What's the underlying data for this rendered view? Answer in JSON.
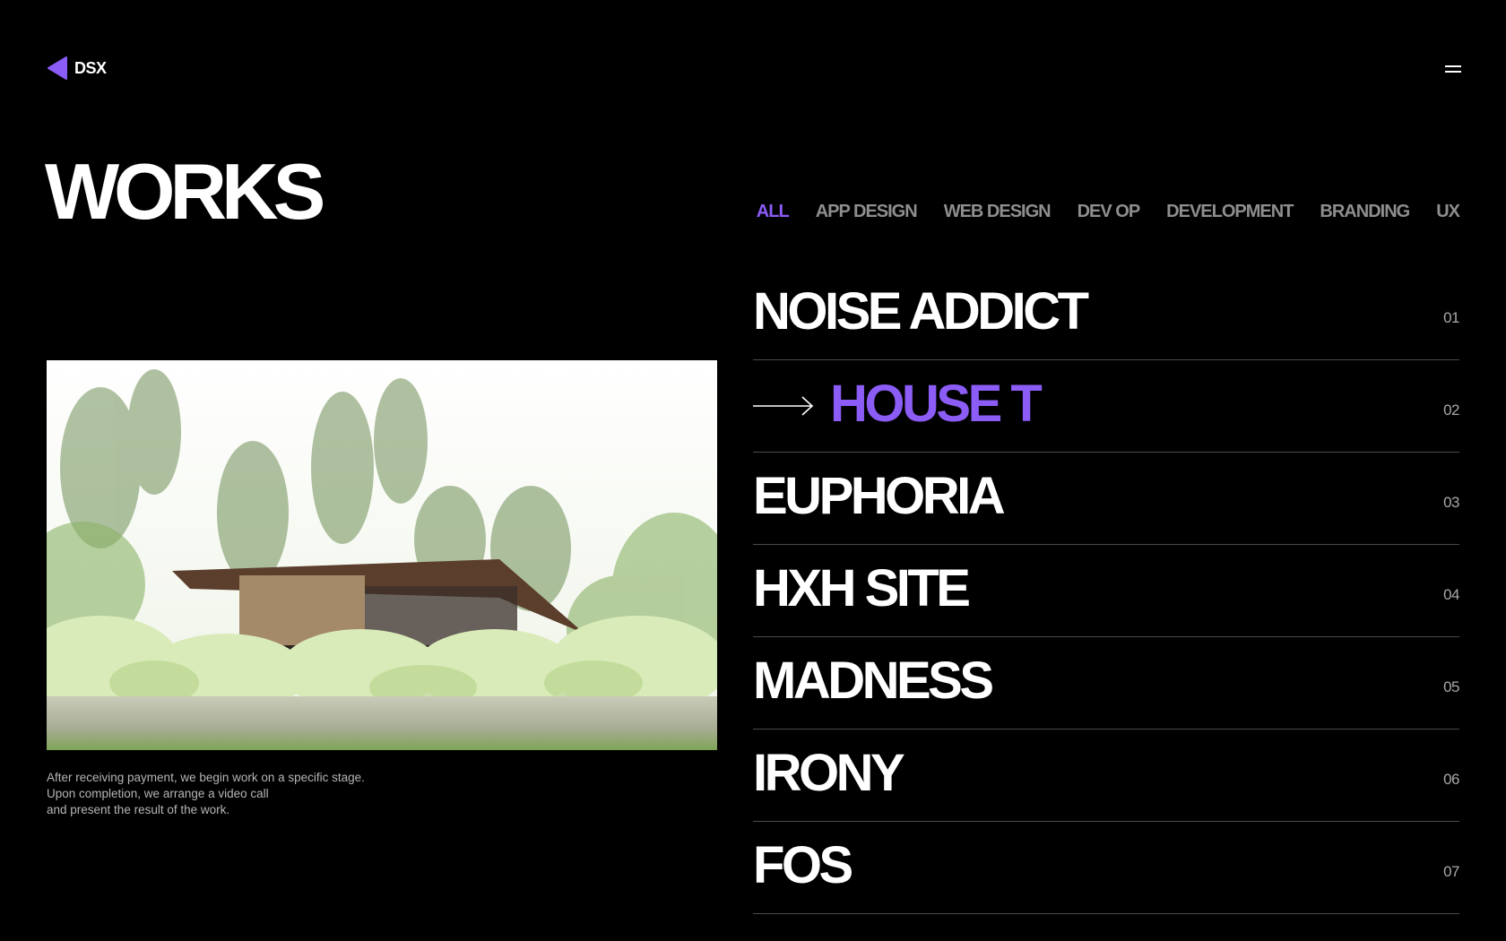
{
  "brand": {
    "name": "DSX",
    "logo_icon": "triangle-left-icon",
    "accent": "#8b5cf6"
  },
  "header": {
    "menu_icon": "hamburger-icon"
  },
  "page": {
    "title": "WORKS"
  },
  "filters": [
    {
      "label": "ALL",
      "active": true
    },
    {
      "label": "APP DESIGN",
      "active": false
    },
    {
      "label": "WEB DESIGN",
      "active": false
    },
    {
      "label": "DEV OP",
      "active": false
    },
    {
      "label": "DEVELOPMENT",
      "active": false
    },
    {
      "label": "BRANDING",
      "active": false
    },
    {
      "label": "UX",
      "active": false
    }
  ],
  "preview": {
    "caption_lines": [
      "After receiving payment, we begin work on a specific stage.",
      "Upon completion, we arrange a video call",
      "and present the result of the work."
    ]
  },
  "works": [
    {
      "title": "NOISE ADDICT",
      "number": "01",
      "active": false
    },
    {
      "title": "HOUSE T",
      "number": "02",
      "active": true
    },
    {
      "title": "EUPHORIA",
      "number": "03",
      "active": false
    },
    {
      "title": "HXH SITE",
      "number": "04",
      "active": false
    },
    {
      "title": "MADNESS",
      "number": "05",
      "active": false
    },
    {
      "title": "IRONY",
      "number": "06",
      "active": false
    },
    {
      "title": "FOS",
      "number": "07",
      "active": false
    }
  ]
}
